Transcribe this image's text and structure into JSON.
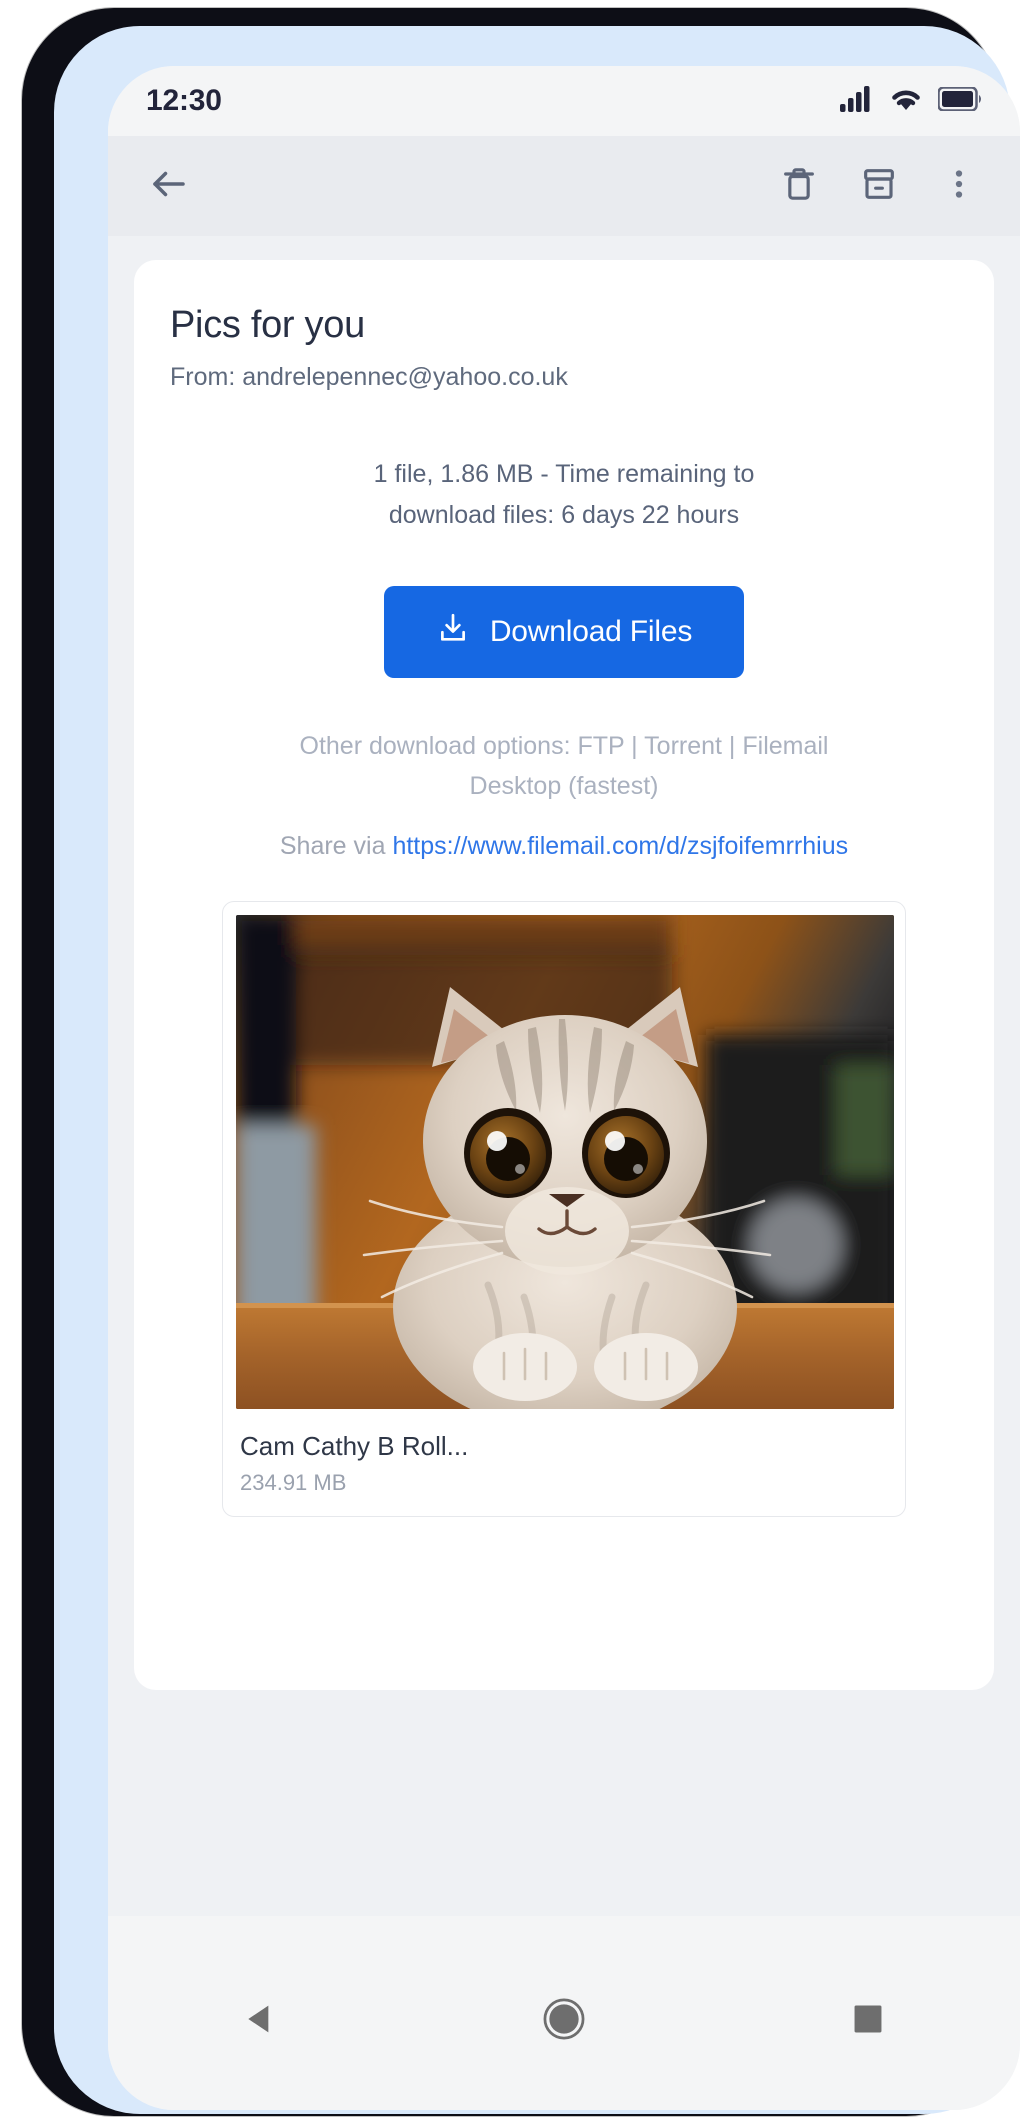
{
  "status_bar": {
    "time": "12:30",
    "icons": [
      "signal-icon",
      "wifi-icon",
      "battery-icon"
    ]
  },
  "toolbar": {
    "back_icon": "back-arrow-icon",
    "delete_icon": "trash-icon",
    "archive_icon": "archive-icon",
    "more_icon": "more-vertical-icon"
  },
  "email": {
    "subject": "Pics for you",
    "from": "From: andrelepennec@yahoo.co.uk",
    "info_line_1": "1 file, 1.86 MB - Time remaining to",
    "info_line_2": "download files: 6 days 22 hours",
    "download_button": "Download Files",
    "download_icon": "download-icon",
    "other_options_line_1": "Other download options: FTP | Torrent | Filemail",
    "other_options_line_2": "Desktop (fastest)",
    "share_prefix": "Share via ",
    "share_url": "https://www.filemail.com/d/zsjfoifemrrhius"
  },
  "attachment": {
    "thumbnail_alt": "kitten-photo",
    "name": "Cam Cathy B Roll...",
    "size": "234.91 MB"
  },
  "nav_bar": {
    "back": "nav-back-icon",
    "home": "nav-home-icon",
    "recents": "nav-recents-icon"
  },
  "colors": {
    "accent_blue": "#1668e3",
    "link_blue": "#2f76e8",
    "toolbar_bg": "#e9ebef",
    "body_bg": "#eff1f4",
    "card_bg": "#ffffff",
    "muted_text": "#aab1bf"
  }
}
